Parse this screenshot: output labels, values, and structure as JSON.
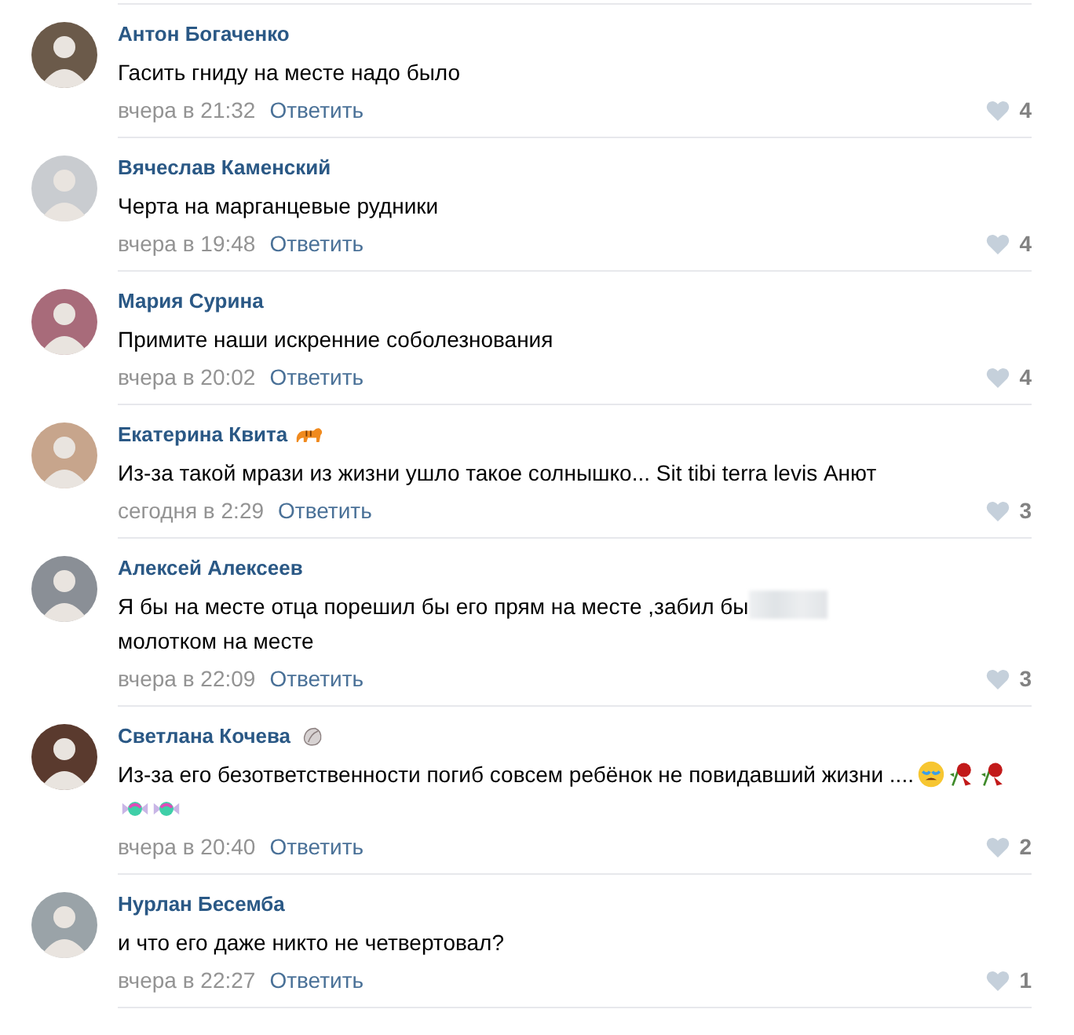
{
  "comments": [
    {
      "author": "Антон Богаченко",
      "text": [
        {
          "kind": "text",
          "text": "Гасить гниду на месте надо было"
        }
      ],
      "time": "вчера в 21:32",
      "reply": "Ответить",
      "likes": "4"
    },
    {
      "author": "Вячеслав Каменский",
      "text": [
        {
          "kind": "text",
          "text": "Черта на марганцевые рудники"
        }
      ],
      "time": "вчера в 19:48",
      "reply": "Ответить",
      "likes": "4"
    },
    {
      "author": "Мария Сурина",
      "text": [
        {
          "kind": "text",
          "text": "Примите наши искренние соболезнования"
        }
      ],
      "time": "вчера в 20:02",
      "reply": "Ответить",
      "likes": "4"
    },
    {
      "author": "Екатерина Квита",
      "badge": {
        "kind": "tiger"
      },
      "text": [
        {
          "kind": "text",
          "text": "Из-за такой мрази из жизни ушло такое солнышко... Sit tibi terra levis Анют"
        }
      ],
      "time": "сегодня в 2:29",
      "reply": "Ответить",
      "likes": "3"
    },
    {
      "author": "Алексей Алексеев",
      "text": [
        {
          "kind": "text",
          "text": "Я бы на месте отца порешил бы его прям на месте ,забил бы"
        },
        {
          "kind": "blur"
        },
        {
          "kind": "break"
        },
        {
          "kind": "text",
          "text": "молотком на месте"
        }
      ],
      "time": "вчера в 22:09",
      "reply": "Ответить",
      "likes": "3"
    },
    {
      "author": "Светлана Кочева",
      "badge": {
        "kind": "shell"
      },
      "text": [
        {
          "kind": "text",
          "text": "Из-за его безответственности погиб совсем ребёнок не повидавший жизни ...."
        },
        {
          "kind": "crying"
        },
        {
          "kind": "rose"
        },
        {
          "kind": "rose"
        },
        {
          "kind": "candy"
        },
        {
          "kind": "candy"
        }
      ],
      "time": "вчера в 20:40",
      "reply": "Ответить",
      "likes": "2"
    },
    {
      "author": "Нурлан Бесемба",
      "text": [
        {
          "kind": "text",
          "text": "и что его даже никто не четвертовал?"
        }
      ],
      "time": "вчера в 22:27",
      "reply": "Ответить",
      "likes": "1"
    }
  ]
}
